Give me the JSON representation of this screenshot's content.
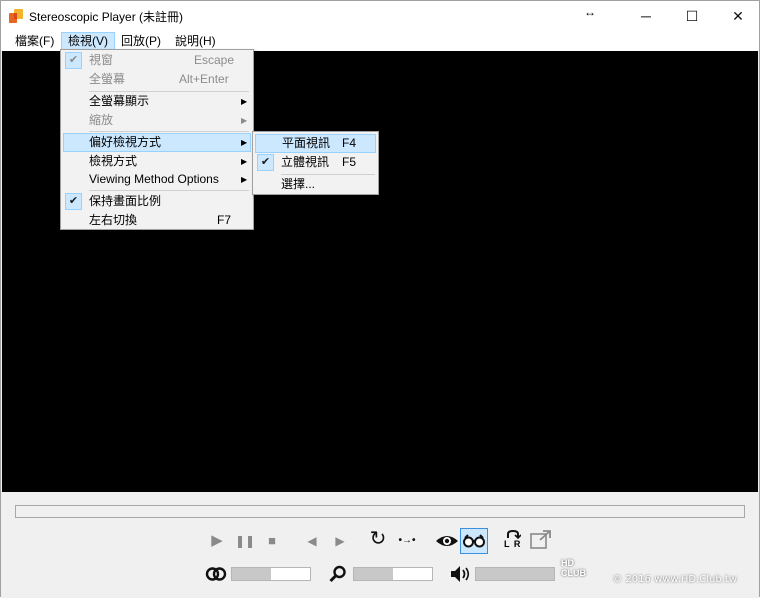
{
  "window": {
    "title": "Stereoscopic Player (未註冊)",
    "resize_icon": "↔",
    "minimize_icon": "─",
    "maximize_icon": "☐",
    "close_icon": "✕"
  },
  "menubar": {
    "items": [
      {
        "label": "檔案(F)"
      },
      {
        "label": "檢視(V)"
      },
      {
        "label": "回放(P)"
      },
      {
        "label": "說明(H)"
      }
    ]
  },
  "view_menu": {
    "items": [
      {
        "label": "視窗",
        "accel": "Escape",
        "checked": true,
        "disabled": true
      },
      {
        "label": "全螢幕",
        "accel": "Alt+Enter",
        "disabled": true
      },
      {
        "label": "全螢幕顯示",
        "submenu": true
      },
      {
        "label": "縮放",
        "submenu": true,
        "disabled": true
      },
      {
        "label": "偏好檢視方式",
        "submenu": true,
        "highlighted": true
      },
      {
        "label": "檢視方式",
        "submenu": true
      },
      {
        "label": "Viewing Method Options",
        "submenu": true
      },
      {
        "label": "保持畫面比例",
        "checked": true
      },
      {
        "label": "左右切換",
        "accel": "F7"
      }
    ]
  },
  "submenu": {
    "items": [
      {
        "label": "平面視訊",
        "accel": "F4",
        "highlighted": true
      },
      {
        "label": "立體視訊",
        "accel": "F5",
        "checked": true
      },
      {
        "label": "選擇..."
      }
    ]
  },
  "controls": {
    "play_icon": "▶",
    "pause_icon": "❚❚",
    "stop_icon": "■",
    "prev_icon": "◀",
    "next_icon": "▶",
    "loop_icon": "↻",
    "step_icon": "•→•",
    "eye_icon": "👁",
    "glasses_icon": "👓",
    "swap_lr_label": "L R",
    "popout_icon": "⇗",
    "stereo_icon": "◎",
    "zoom_icon": "🔍",
    "volume_icon": "🔊",
    "sliders": {
      "stereo_level": 0.5,
      "zoom_level": 0.5,
      "volume_level": 1.0
    }
  },
  "watermark": {
    "logo": "HD CLUB",
    "text": "© 2016  www.HD.Club.tw"
  }
}
